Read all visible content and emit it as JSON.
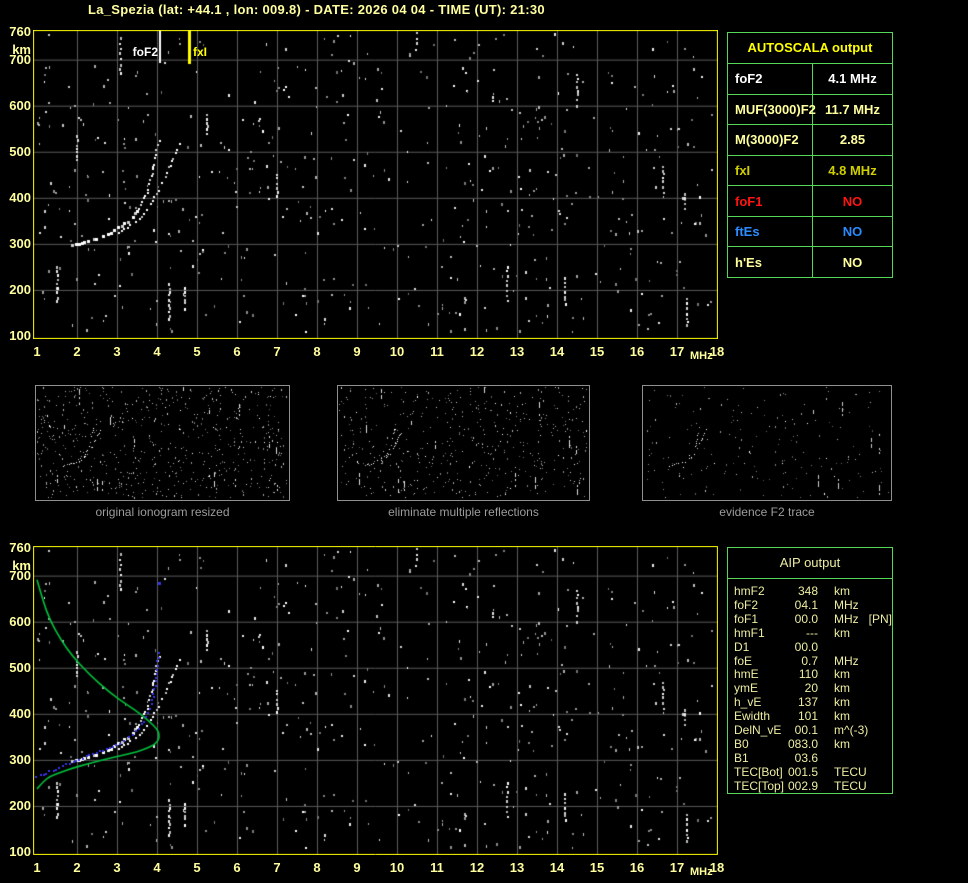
{
  "title": "La_Spezia (lat: +44.1 , lon: 009.8) - DATE: 2026 04 04 - TIME (UT): 21:30",
  "colors": {
    "frame_yellow": "#FFFF00",
    "label_yellow": "#FFFF9E",
    "table_green": "#55D855",
    "grid_gray": "#5A5A5A",
    "profile_green": "#00C23C",
    "trace_blue": "#3434E8",
    "caption_gray": "#9C9C9C",
    "noise_white": "#FFFFFF"
  },
  "autoscala": {
    "header": "AUTOSCALA output",
    "rows": [
      {
        "label": "foF2",
        "value": "4.1 MHz",
        "color": "#FFFFFF"
      },
      {
        "label": "MUF(3000)F2",
        "value": "11.7 MHz",
        "color": "#FFFF9E"
      },
      {
        "label": "M(3000)F2",
        "value": "2.85",
        "color": "#FFFF9E"
      },
      {
        "label": "fxI",
        "value": "4.8 MHz",
        "color": "#CFCF00"
      },
      {
        "label": "foF1",
        "value": "NO",
        "color": "#FF1414"
      },
      {
        "label": "ftEs",
        "value": "NO",
        "color": "#2A8CFF"
      },
      {
        "label": "h'Es",
        "value": "NO",
        "color": "#FFFF9E"
      }
    ]
  },
  "aip": {
    "header": "AIP output",
    "rows": [
      {
        "label": "hmF2",
        "value": "348",
        "unit": "km",
        "note": ""
      },
      {
        "label": "foF2",
        "value": "04.1",
        "unit": "MHz",
        "note": ""
      },
      {
        "label": "foF1",
        "value": "00.0",
        "unit": "MHz",
        "note": "[PN]"
      },
      {
        "label": "hmF1",
        "value": "---",
        "unit": "km",
        "note": ""
      },
      {
        "label": "D1",
        "value": "00.0",
        "unit": "",
        "note": ""
      },
      {
        "label": "foE",
        "value": "0.7",
        "unit": "MHz",
        "note": ""
      },
      {
        "label": "hmE",
        "value": "110",
        "unit": "km",
        "note": ""
      },
      {
        "label": "ymE",
        "value": "20",
        "unit": "km",
        "note": ""
      },
      {
        "label": "h_vE",
        "value": "137",
        "unit": "km",
        "note": ""
      },
      {
        "label": "Ewidth",
        "value": "101",
        "unit": "km",
        "note": ""
      },
      {
        "label": "DelN_vE",
        "value": "00.1",
        "unit": "m^(-3)",
        "note": ""
      },
      {
        "label": "B0",
        "value": "083.0",
        "unit": "km",
        "note": ""
      },
      {
        "label": "B1",
        "value": "03.6",
        "unit": "",
        "note": ""
      },
      {
        "label": "TEC[Bot]",
        "value": "001.5",
        "unit": "TECU",
        "note": ""
      },
      {
        "label": "TEC[Top]",
        "value": "002.9",
        "unit": "TECU",
        "note": ""
      }
    ]
  },
  "thumbnails": [
    {
      "caption": "original ionogram resized"
    },
    {
      "caption": "eliminate multiple reflections"
    },
    {
      "caption": "evidence F2 trace"
    }
  ],
  "axes": {
    "x_unit": "MHz",
    "y_unit": "km"
  },
  "noise": {
    "seed": 20260404,
    "dots_main": 540,
    "dots_thumbs": [
      620,
      470,
      190
    ]
  },
  "chart_data": [
    {
      "id": "ionogram_main",
      "type": "scatter",
      "title": "ionogram echoes with autoscaled characteristics",
      "xlabel": "MHz",
      "ylabel": "km",
      "x_range": [
        1,
        18
      ],
      "y_range": [
        100,
        760
      ],
      "x_ticks": [
        "1",
        "2",
        "3",
        "4",
        "5",
        "6",
        "7",
        "8",
        "9",
        "10",
        "11",
        "12",
        "13",
        "14",
        "15",
        "16",
        "17",
        "18"
      ],
      "y_ticks": [
        "760",
        "700",
        "600",
        "500",
        "400",
        "300",
        "200",
        "100"
      ],
      "y_tick_values": [
        760,
        700,
        600,
        500,
        400,
        300,
        200,
        100
      ],
      "grid": true,
      "series": [
        {
          "name": "F2_trace_O_mode",
          "color": "#FFFFFF",
          "points": [
            [
              1.9,
              295
            ],
            [
              2.2,
              302
            ],
            [
              2.5,
              311
            ],
            [
              2.8,
              321
            ],
            [
              3.0,
              330
            ],
            [
              3.2,
              342
            ],
            [
              3.4,
              358
            ],
            [
              3.55,
              376
            ],
            [
              3.7,
              398
            ],
            [
              3.82,
              424
            ],
            [
              3.9,
              452
            ],
            [
              3.97,
              480
            ],
            [
              4.03,
              508
            ],
            [
              4.08,
              528
            ]
          ]
        },
        {
          "name": "F2_trace_X_mode",
          "color": "#FFFFFF",
          "points": [
            [
              3.05,
              322
            ],
            [
              3.3,
              334
            ],
            [
              3.5,
              348
            ],
            [
              3.7,
              366
            ],
            [
              3.85,
              386
            ],
            [
              4.0,
              408
            ],
            [
              4.15,
              432
            ],
            [
              4.3,
              458
            ],
            [
              4.42,
              482
            ],
            [
              4.55,
              506
            ],
            [
              4.65,
              522
            ]
          ]
        }
      ],
      "interference_streaks": [
        [
          1.5,
          175,
          250
        ],
        [
          2.0,
          472,
          535
        ],
        [
          3.08,
          665,
          748
        ],
        [
          4.32,
          135,
          215
        ],
        [
          4.7,
          155,
          205
        ],
        [
          5.25,
          535,
          580
        ],
        [
          7.0,
          395,
          450
        ],
        [
          10.5,
          732,
          758
        ],
        [
          12.4,
          600,
          620
        ],
        [
          12.75,
          170,
          250
        ],
        [
          14.2,
          160,
          228
        ],
        [
          14.5,
          597,
          668
        ],
        [
          16.65,
          405,
          468
        ],
        [
          17.2,
          368,
          410
        ],
        [
          17.25,
          124,
          182
        ]
      ],
      "markers": [
        {
          "label": "foF2",
          "mhz": 4.1,
          "color": "#FFFFFF"
        },
        {
          "label": "fxI",
          "mhz": 4.8,
          "color": "#FFFF00"
        }
      ]
    },
    {
      "id": "ionogram_aip_fit",
      "type": "scatter",
      "title": "ionogram with restored trace and electron density profile",
      "xlabel": "MHz",
      "ylabel": "km",
      "x_range": [
        1,
        18
      ],
      "y_range": [
        100,
        760
      ],
      "x_ticks": [
        "1",
        "2",
        "3",
        "4",
        "5",
        "6",
        "7",
        "8",
        "9",
        "10",
        "11",
        "12",
        "13",
        "14",
        "15",
        "16",
        "17",
        "18"
      ],
      "y_ticks": [
        "760",
        "700",
        "600",
        "500",
        "400",
        "300",
        "200",
        "100"
      ],
      "y_tick_values": [
        760,
        700,
        600,
        500,
        400,
        300,
        200,
        100
      ],
      "grid": true,
      "series": [
        {
          "name": "restored_trace_blue",
          "color": "#3434E8",
          "points": [
            [
              1.0,
              261
            ],
            [
              1.25,
              270
            ],
            [
              1.5,
              279
            ],
            [
              1.75,
              288
            ],
            [
              2.0,
              297
            ],
            [
              2.25,
              306
            ],
            [
              2.5,
              314
            ],
            [
              2.75,
              322
            ],
            [
              3.0,
              331
            ],
            [
              3.2,
              341
            ],
            [
              3.4,
              353
            ],
            [
              3.55,
              366
            ],
            [
              3.7,
              382
            ],
            [
              3.8,
              400
            ],
            [
              3.88,
              420
            ],
            [
              3.94,
              443
            ],
            [
              3.99,
              468
            ],
            [
              4.02,
              495
            ],
            [
              4.04,
              520
            ],
            [
              4.05,
              540
            ]
          ],
          "extra_points": [
            [
              4.07,
              682
            ]
          ]
        },
        {
          "name": "density_profile_green",
          "color": "#00C23C",
          "points": [
            [
              1.0,
              691
            ],
            [
              1.15,
              645
            ],
            [
              1.33,
              602
            ],
            [
              1.6,
              560
            ],
            [
              1.88,
              526
            ],
            [
              2.3,
              486
            ],
            [
              2.83,
              445
            ],
            [
              3.3,
              417
            ],
            [
              3.58,
              400
            ],
            [
              3.85,
              380
            ],
            [
              4.0,
              367
            ],
            [
              4.06,
              355
            ],
            [
              4.04,
              344
            ],
            [
              3.95,
              334
            ],
            [
              3.75,
              325
            ],
            [
              3.4,
              315
            ],
            [
              2.83,
              304
            ],
            [
              2.3,
              292
            ],
            [
              1.88,
              282
            ],
            [
              1.6,
              273
            ],
            [
              1.33,
              265
            ],
            [
              1.15,
              252
            ],
            [
              1.0,
              237
            ]
          ]
        }
      ]
    }
  ]
}
